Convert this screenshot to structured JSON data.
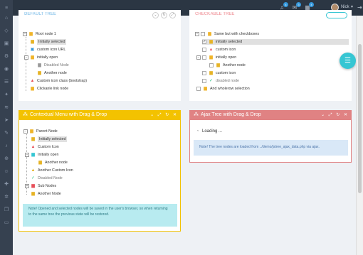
{
  "topbar": {
    "badges": [
      "4",
      "3",
      "4"
    ],
    "username": "Nick"
  },
  "panels": {
    "default_tree": {
      "title": "DEFAULT TREE",
      "nodes": [
        "Root node 1",
        "Initially selected",
        "custom icon URL",
        "initially open",
        "Disabled Node",
        "Another node",
        "Custom icon class (bootstrap)",
        "Clickanle link node"
      ]
    },
    "checkable_tree": {
      "title": "CHECKABLE TREE",
      "nodes": [
        "Same but with checkboxes",
        "initially selected",
        "custom icon",
        "initially open",
        "Another node",
        "custom icon",
        "disabled node",
        "And wholerow selection"
      ]
    },
    "contextual": {
      "title": "Contextual Menu with Drag & Drop",
      "nodes": [
        "Parent Node",
        "Initially selected",
        "Custom Icon",
        "Initially open",
        "Another node",
        "Another Custom Icon",
        "Disabled Node",
        "Sub Nodes",
        "Another Node"
      ],
      "note": "Note! Opened and selected nodes will be saved in the user's browser, so when returning to the same tree the previous state will be restored."
    },
    "ajax": {
      "title": "Ajax Tree with Drag & Drop",
      "loading": "Loading ...",
      "note": "Note! The tree nodes are loaded from ../demo/jstree_ajax_data.php via ajax."
    }
  },
  "colors": {
    "sidebar": "#364150",
    "topbar": "#2b3643",
    "yellow_header": "#f3c200",
    "red_header": "#e08283",
    "note_cyan": "#b8ebf0",
    "note_blue": "#d9e8f7",
    "fab": "#36c6d3"
  }
}
